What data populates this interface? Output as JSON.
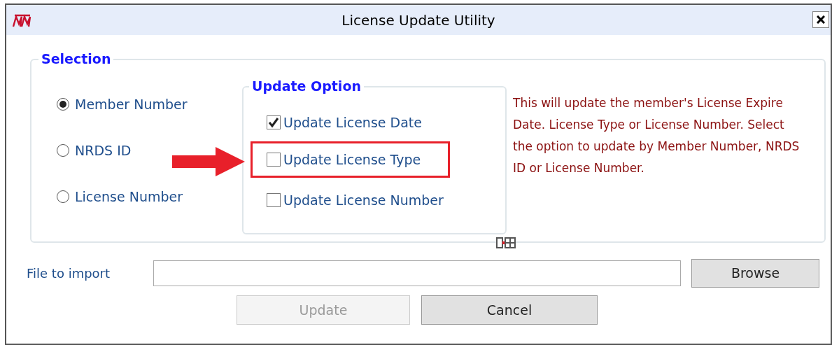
{
  "window": {
    "title": "License Update Utility"
  },
  "selection": {
    "title": "Selection",
    "options": [
      {
        "label": "Member Number",
        "selected": true
      },
      {
        "label": "NRDS ID",
        "selected": false
      },
      {
        "label": "License Number",
        "selected": false
      }
    ]
  },
  "update_option": {
    "title": "Update Option",
    "options": [
      {
        "label": "Update License Date",
        "checked": true,
        "highlighted": false
      },
      {
        "label": "Update License Type",
        "checked": false,
        "highlighted": true
      },
      {
        "label": "Update License Number",
        "checked": false,
        "highlighted": false
      }
    ]
  },
  "description": "This will update the member's License Expire Date. License Type or License Number.  Select the option to update by Member Number, NRDS ID or License Number.",
  "file_import": {
    "label": "File to import"
  },
  "buttons": [
    {
      "label": "Browse",
      "disabled": false
    },
    {
      "label": "Update",
      "disabled": true
    },
    {
      "label": "Cancel",
      "disabled": false
    }
  ]
}
